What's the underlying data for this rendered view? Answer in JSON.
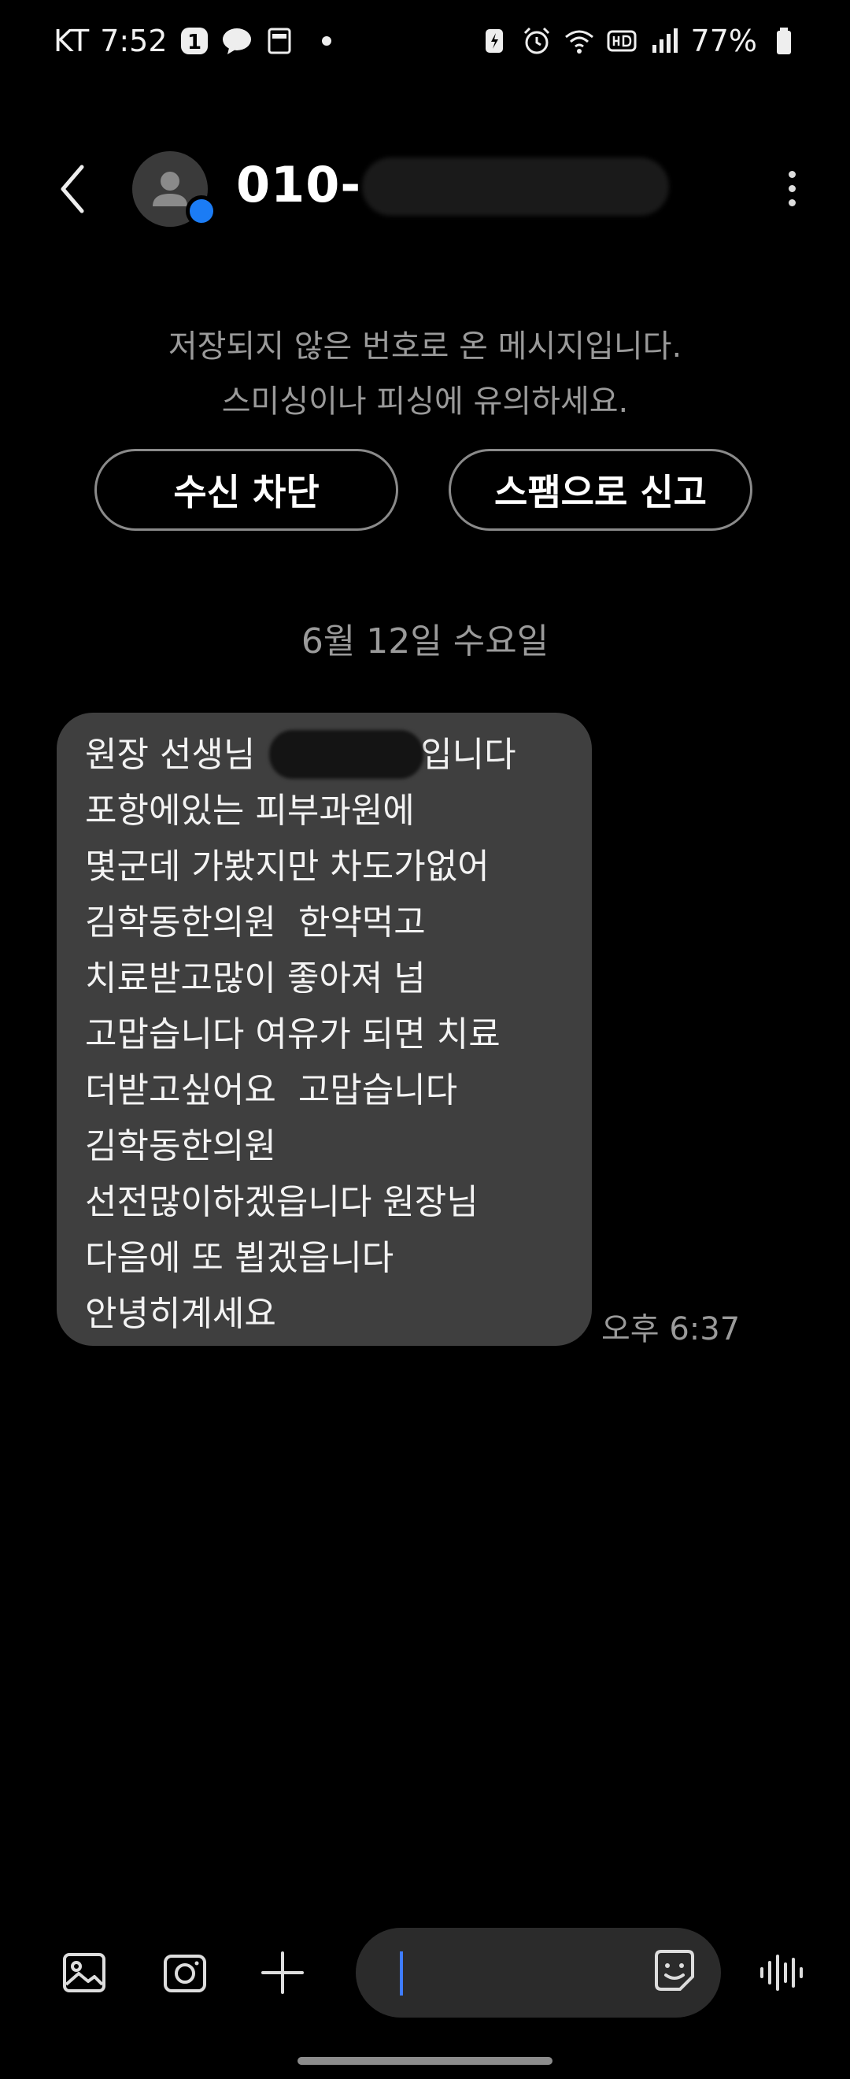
{
  "status_bar": {
    "carrier": "KT",
    "time": "7:52",
    "notif_badge": "1",
    "battery": "77%"
  },
  "header": {
    "contact_number": "010-"
  },
  "notice": {
    "line1": "저장되지 않은 번호로 온 메시지입니다.",
    "line2": "스미싱이나 피싱에 유의하세요."
  },
  "actions": {
    "block_label": "수신 차단",
    "report_label": "스팸으로 신고"
  },
  "date_separator": "6월 12일 수요일",
  "message": {
    "lines": [
      "원장 선생님               입니다",
      "포항에있는 피부과원에",
      "몇군데 가봤지만 차도가없어",
      "김학동한의원  한약먹고",
      "치료받고많이 좋아져 넘",
      "고맙습니다 여유가 되면 치료",
      "더받고싶어요  고맙습니다",
      "김학동한의원",
      "선전많이하겠읍니다 원장님",
      "다음에 또 뵙겠읍니다",
      "안녕히계세요"
    ],
    "time": "오후 6:37"
  },
  "icons": {
    "back": "back-arrow-icon",
    "more": "more-vertical-icon",
    "gallery": "gallery-icon",
    "camera": "camera-icon",
    "add": "plus-icon",
    "sticker": "sticker-icon",
    "voice": "voice-wave-icon"
  },
  "colors": {
    "background": "#000000",
    "bubble": "#3f3f3f",
    "badge": "#1b7cf5",
    "caret": "#3f7cff"
  }
}
